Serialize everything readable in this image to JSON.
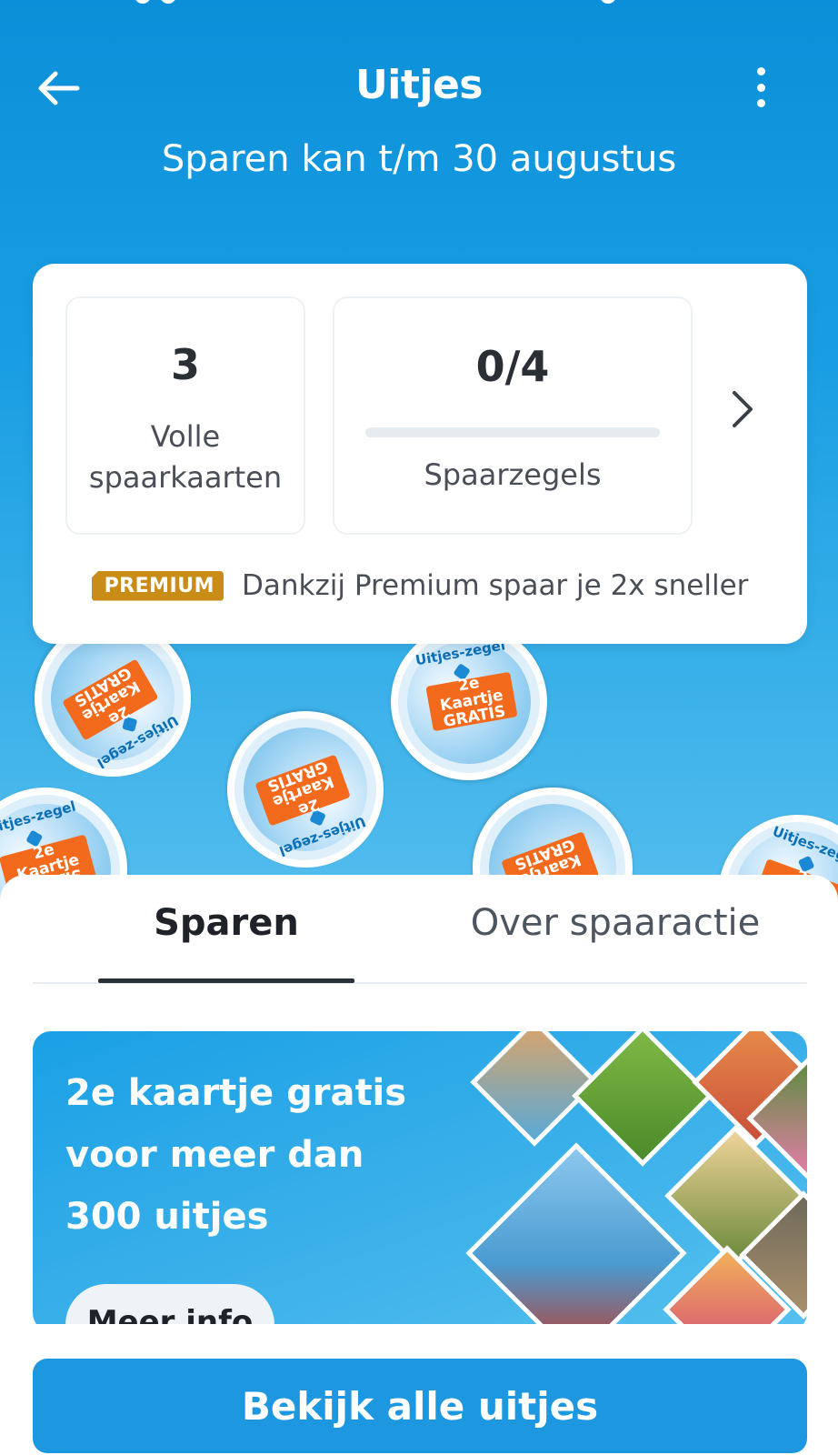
{
  "header": {
    "title": "Uitjes",
    "subtitle": "Sparen kan t/m 30 augustus",
    "back_icon": "arrow-left-icon",
    "menu_icon": "more-vertical-icon"
  },
  "stats": {
    "full_cards": {
      "value": "3",
      "label": "Volle spaarkaarten"
    },
    "stamps": {
      "value": "0/4",
      "label": "Spaarzegels",
      "progress": 0
    },
    "chevron_icon": "chevron-right-icon"
  },
  "premium": {
    "badge": "PREMIUM",
    "text": "Dankzij Premium spaar je 2x sneller"
  },
  "tabs": [
    {
      "label": "Sparen",
      "active": true
    },
    {
      "label": "Over spaaractie",
      "active": false
    }
  ],
  "promo": {
    "line1": "2e kaartje gratis",
    "line2": "voor meer dan",
    "line3": "300 uitjes",
    "button": "Meer info"
  },
  "cta": {
    "label": "Bekijk alle uitjes"
  },
  "colors": {
    "brand_blue": "#1d98e0",
    "premium_gold": "#c98d17",
    "stamp_orange": "#f36a1c"
  }
}
